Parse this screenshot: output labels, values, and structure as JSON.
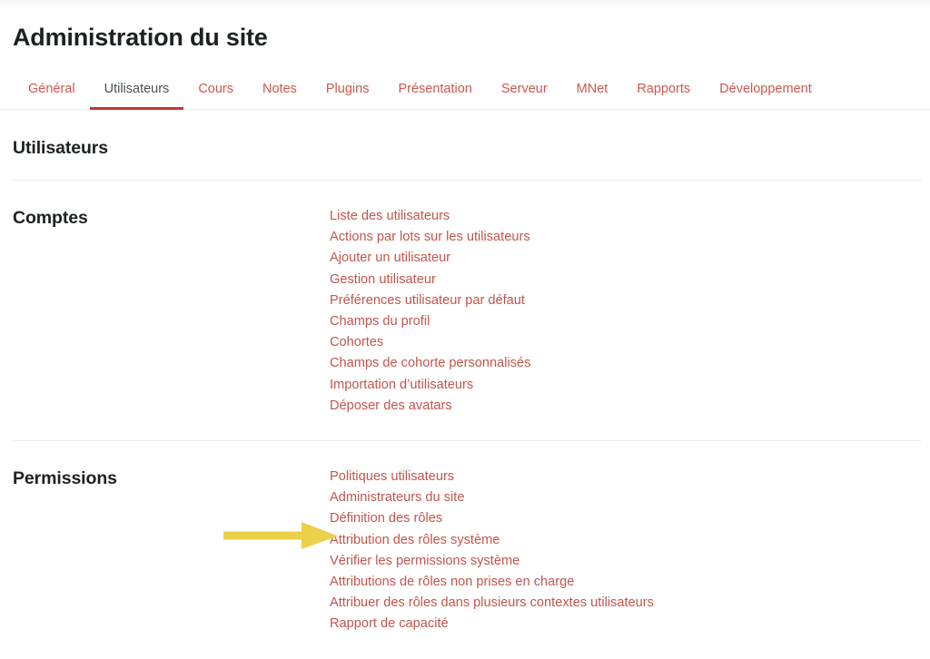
{
  "page": {
    "title": "Administration du site"
  },
  "tabs": [
    {
      "label": "Général",
      "active": false
    },
    {
      "label": "Utilisateurs",
      "active": true
    },
    {
      "label": "Cours",
      "active": false
    },
    {
      "label": "Notes",
      "active": false
    },
    {
      "label": "Plugins",
      "active": false
    },
    {
      "label": "Présentation",
      "active": false
    },
    {
      "label": "Serveur",
      "active": false
    },
    {
      "label": "MNet",
      "active": false
    },
    {
      "label": "Rapports",
      "active": false
    },
    {
      "label": "Développement",
      "active": false
    }
  ],
  "sections": [
    {
      "title": "Utilisateurs",
      "links": []
    },
    {
      "title": "Comptes",
      "links": [
        "Liste des utilisateurs",
        "Actions par lots sur les utilisateurs",
        "Ajouter un utilisateur",
        "Gestion utilisateur",
        "Préférences utilisateur par défaut",
        "Champs du profil",
        "Cohortes",
        "Champs de cohorte personnalisés",
        "Importation d’utilisateurs",
        "Déposer des avatars"
      ]
    },
    {
      "title": "Permissions",
      "links": [
        "Politiques utilisateurs",
        "Administrateurs du site",
        "Définition des rôles",
        "Attribution des rôles système",
        "Vérifier les permissions système",
        "Attributions de rôles non prises en charge",
        "Attribuer des rôles dans plusieurs contextes utilisateurs",
        "Rapport de capacité"
      ]
    }
  ],
  "annotation": {
    "type": "arrow",
    "color": "#edd04a",
    "points_to": "Attribution des rôles système"
  },
  "colors": {
    "link": "#c2554c",
    "tab_inactive": "#d1564d",
    "tab_active_text": "#4b5055",
    "tab_active_underline": "#c0392b",
    "heading": "#1d2125",
    "divider": "#e9eaec",
    "background": "#ffffff",
    "annotation_arrow": "#edd04a"
  }
}
